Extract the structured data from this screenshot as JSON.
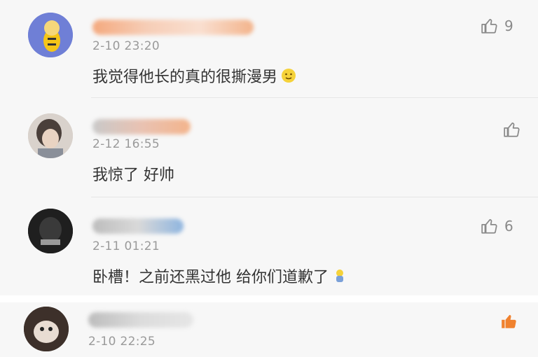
{
  "comments": [
    {
      "time": "2-10 23:20",
      "text": "我觉得他长的真的很撕漫男",
      "likes": "9",
      "avatar": "cartoon-avatar",
      "emoji": "smile-emoji"
    },
    {
      "time": "2-12 16:55",
      "text": "我惊了 好帅",
      "likes": "",
      "avatar": "photo-avatar"
    },
    {
      "time": "2-11 01:21",
      "text": "卧槽！之前还黑过他 给你们道歉了",
      "likes": "6",
      "avatar": "dark-avatar",
      "emoji": "bow-emoji"
    },
    {
      "time": "2-10 22:25",
      "text": "",
      "likes": "",
      "avatar": "cat-avatar",
      "liked": true
    }
  ],
  "colors": {
    "liked": "#f0822f",
    "muted": "#8a8a8a",
    "text": "#333333",
    "time": "#9a9a9a"
  }
}
